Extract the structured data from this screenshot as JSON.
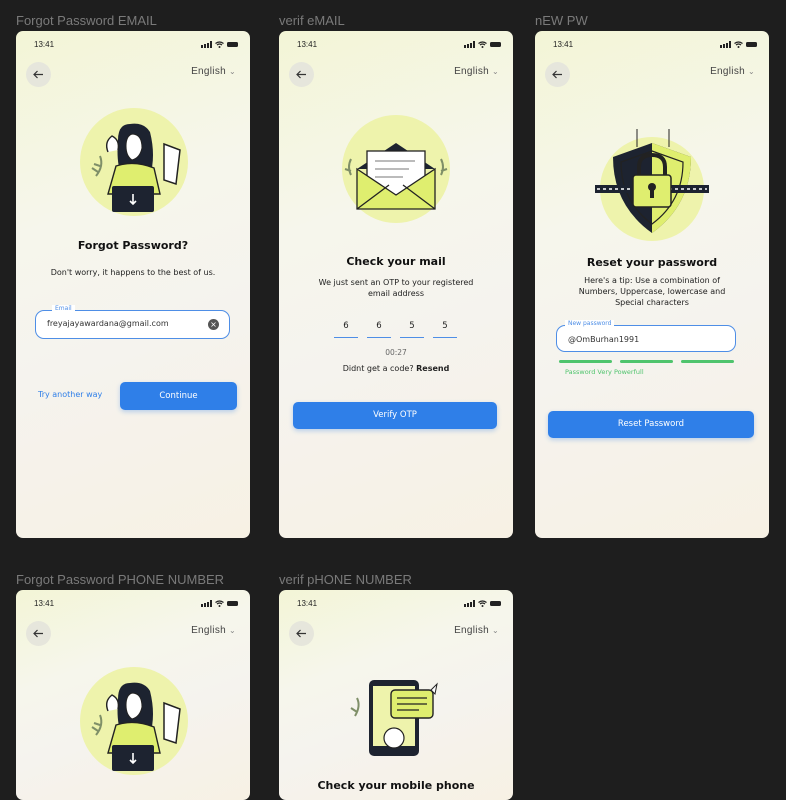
{
  "frames": [
    {
      "label": "Forgot Password EMAIL",
      "time": "13:41",
      "language": "English",
      "title": "Forgot Password?",
      "subtitle": "Don't worry, it happens to the best of us.",
      "email_label": "Email",
      "email_value": "freyajayawardana@gmail.com",
      "alt_link": "Try another way",
      "cta": "Continue"
    },
    {
      "label": "verif eMAIL",
      "time": "13:41",
      "language": "English",
      "title": "Check your mail",
      "subtitle": "We just sent an OTP to your registered email address",
      "otp": [
        "6",
        "6",
        "5",
        "5"
      ],
      "timer": "00:27",
      "resend_prompt": "Didnt get a code?",
      "resend_link": "Resend",
      "cta": "Verify OTP"
    },
    {
      "label": "nEW PW",
      "time": "13:41",
      "language": "English",
      "title": "Reset your password",
      "subtitle": "Here's a tip: Use a combination of Numbers, Uppercase, lowercase and Special characters",
      "pw_label": "New password",
      "pw_value": "@OmBurhan1991",
      "strength_text": "Password Very Powerfull",
      "cta": "Reset Password"
    },
    {
      "label": "Forgot Password PHONE NUMBER",
      "time": "13:41",
      "language": "English"
    },
    {
      "label": "verif pHONE NUMBER",
      "time": "13:41",
      "language": "English",
      "title": "Check your mobile phone"
    }
  ],
  "colors": {
    "accent": "#2f7fe8",
    "highlight": "#dfee6f",
    "success": "#4fc46d",
    "canvas": "#1e1e1e"
  },
  "icons": [
    "back-arrow-icon",
    "chevron-down-icon",
    "signal-icon",
    "wifi-icon",
    "battery-icon",
    "clear-icon"
  ]
}
